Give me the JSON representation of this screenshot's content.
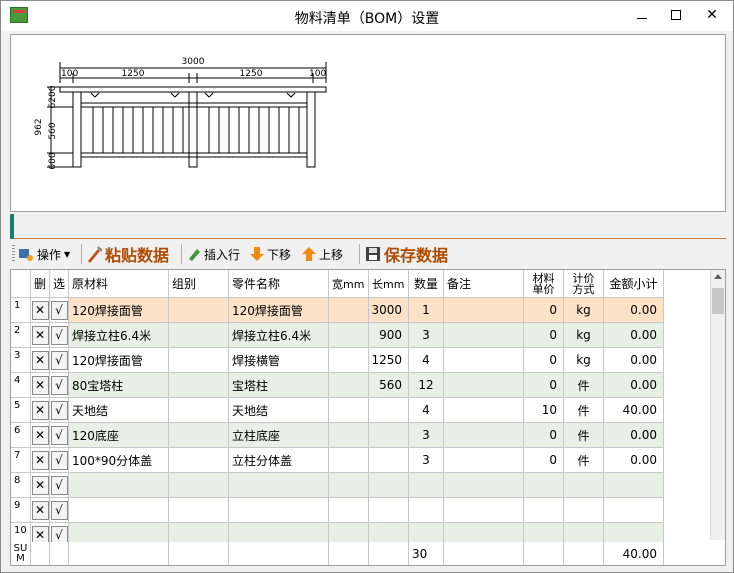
{
  "window": {
    "title": "物料清单（BOM）设置",
    "minimize_glyph": "—",
    "maximize_glyph": "□",
    "close_glyph": "✕"
  },
  "drawing": {
    "total_width": "3000",
    "span_left": "1250",
    "span_right": "1250",
    "edge_left": "100",
    "edge_right": "100",
    "height_total": "962",
    "height_mid": "560",
    "height_top": "6200",
    "height_bottom": "600"
  },
  "toolbar": {
    "operate": "操作",
    "paste": "粘贴数据",
    "insert_row": "插入行",
    "move_down": "下移",
    "move_up": "上移",
    "save": "保存数据"
  },
  "table": {
    "headers": {
      "del": "删",
      "sel": "选",
      "material": "原材料",
      "group": "组别",
      "part": "零件名称",
      "width": "宽mm",
      "length": "长mm",
      "qty": "数量",
      "note": "备注",
      "unit_price": "材料单价",
      "calc": "计价方式",
      "subtotal": "金额小计"
    },
    "del_glyph": "✕",
    "sel_glyph": "√",
    "rows": [
      {
        "num": "1",
        "material": "120焊接面管",
        "group": "",
        "part": "120焊接面管",
        "width": "",
        "length": "3000",
        "qty": "1",
        "note": "",
        "price": "0",
        "calc": "kg",
        "subtotal": "0.00"
      },
      {
        "num": "2",
        "material": "焊接立柱6.4米",
        "group": "",
        "part": "焊接立柱6.4米",
        "width": "",
        "length": "900",
        "qty": "3",
        "note": "",
        "price": "0",
        "calc": "kg",
        "subtotal": "0.00"
      },
      {
        "num": "3",
        "material": "120焊接面管",
        "group": "",
        "part": "焊接横管",
        "width": "",
        "length": "1250",
        "qty": "4",
        "note": "",
        "price": "0",
        "calc": "kg",
        "subtotal": "0.00"
      },
      {
        "num": "4",
        "material": "80宝塔柱",
        "group": "",
        "part": "宝塔柱",
        "width": "",
        "length": "560",
        "qty": "12",
        "note": "",
        "price": "0",
        "calc": "件",
        "subtotal": "0.00"
      },
      {
        "num": "5",
        "material": "天地结",
        "group": "",
        "part": "天地结",
        "width": "",
        "length": "",
        "qty": "4",
        "note": "",
        "price": "10",
        "calc": "件",
        "subtotal": "40.00"
      },
      {
        "num": "6",
        "material": "120底座",
        "group": "",
        "part": "立柱底座",
        "width": "",
        "length": "",
        "qty": "3",
        "note": "",
        "price": "0",
        "calc": "件",
        "subtotal": "0.00"
      },
      {
        "num": "7",
        "material": "100*90分体盖",
        "group": "",
        "part": "立柱分体盖",
        "width": "",
        "length": "",
        "qty": "3",
        "note": "",
        "price": "0",
        "calc": "件",
        "subtotal": "0.00"
      },
      {
        "num": "8",
        "material": "",
        "group": "",
        "part": "",
        "width": "",
        "length": "",
        "qty": "",
        "note": "",
        "price": "",
        "calc": "",
        "subtotal": ""
      },
      {
        "num": "9",
        "material": "",
        "group": "",
        "part": "",
        "width": "",
        "length": "",
        "qty": "",
        "note": "",
        "price": "",
        "calc": "",
        "subtotal": ""
      },
      {
        "num": "10",
        "material": "",
        "group": "",
        "part": "",
        "width": "",
        "length": "",
        "qty": "",
        "note": "",
        "price": "",
        "calc": "",
        "subtotal": ""
      }
    ],
    "sum": {
      "label_top": "SU",
      "label_bottom": "M",
      "qty": "30",
      "subtotal": "40.00"
    }
  },
  "colors": {
    "selected_row": "#fde2c8",
    "alt_row": "#e8f0e5",
    "accent_text": "#b24a00",
    "status_accent": "#1a7f6a"
  }
}
